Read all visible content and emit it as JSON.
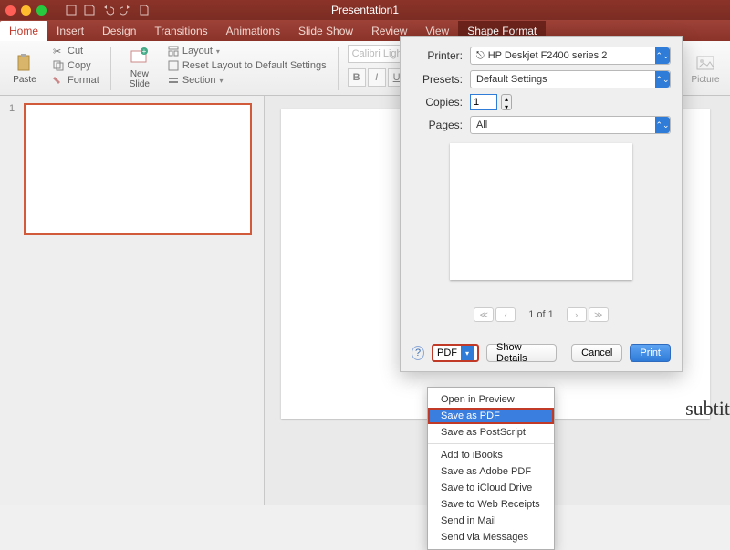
{
  "title": "Presentation1",
  "tabs": [
    "Home",
    "Insert",
    "Design",
    "Transitions",
    "Animations",
    "Slide Show",
    "Review",
    "View",
    "Shape Format"
  ],
  "ribbon": {
    "paste": "Paste",
    "cut": "Cut",
    "copy": "Copy",
    "format": "Format",
    "newSlide": "New\nSlide",
    "layout": "Layout",
    "reset": "Reset Layout to Default Settings",
    "section": "Section",
    "font": "Calibri Light (Headi",
    "picture": "Picture"
  },
  "thumb": {
    "num": "1"
  },
  "print": {
    "printerLbl": "Printer:",
    "printer": "HP Deskjet F2400 series 2",
    "presetsLbl": "Presets:",
    "presets": "Default Settings",
    "copiesLbl": "Copies:",
    "copies": "1",
    "pagesLbl": "Pages:",
    "pages": "All",
    "pager": "1 of 1",
    "help": "?",
    "pdf": "PDF",
    "showDetails": "Show Details",
    "cancel": "Cancel",
    "print": "Print"
  },
  "pdfMenu": {
    "open": "Open in Preview",
    "save": "Save as PDF",
    "ps": "Save as PostScript",
    "ibooks": "Add to iBooks",
    "adobe": "Save as Adobe PDF",
    "icloud": "Save to iCloud Drive",
    "web": "Save to Web Receipts",
    "mail": "Send in Mail",
    "msg": "Send via Messages"
  },
  "subtitle": "subtit"
}
